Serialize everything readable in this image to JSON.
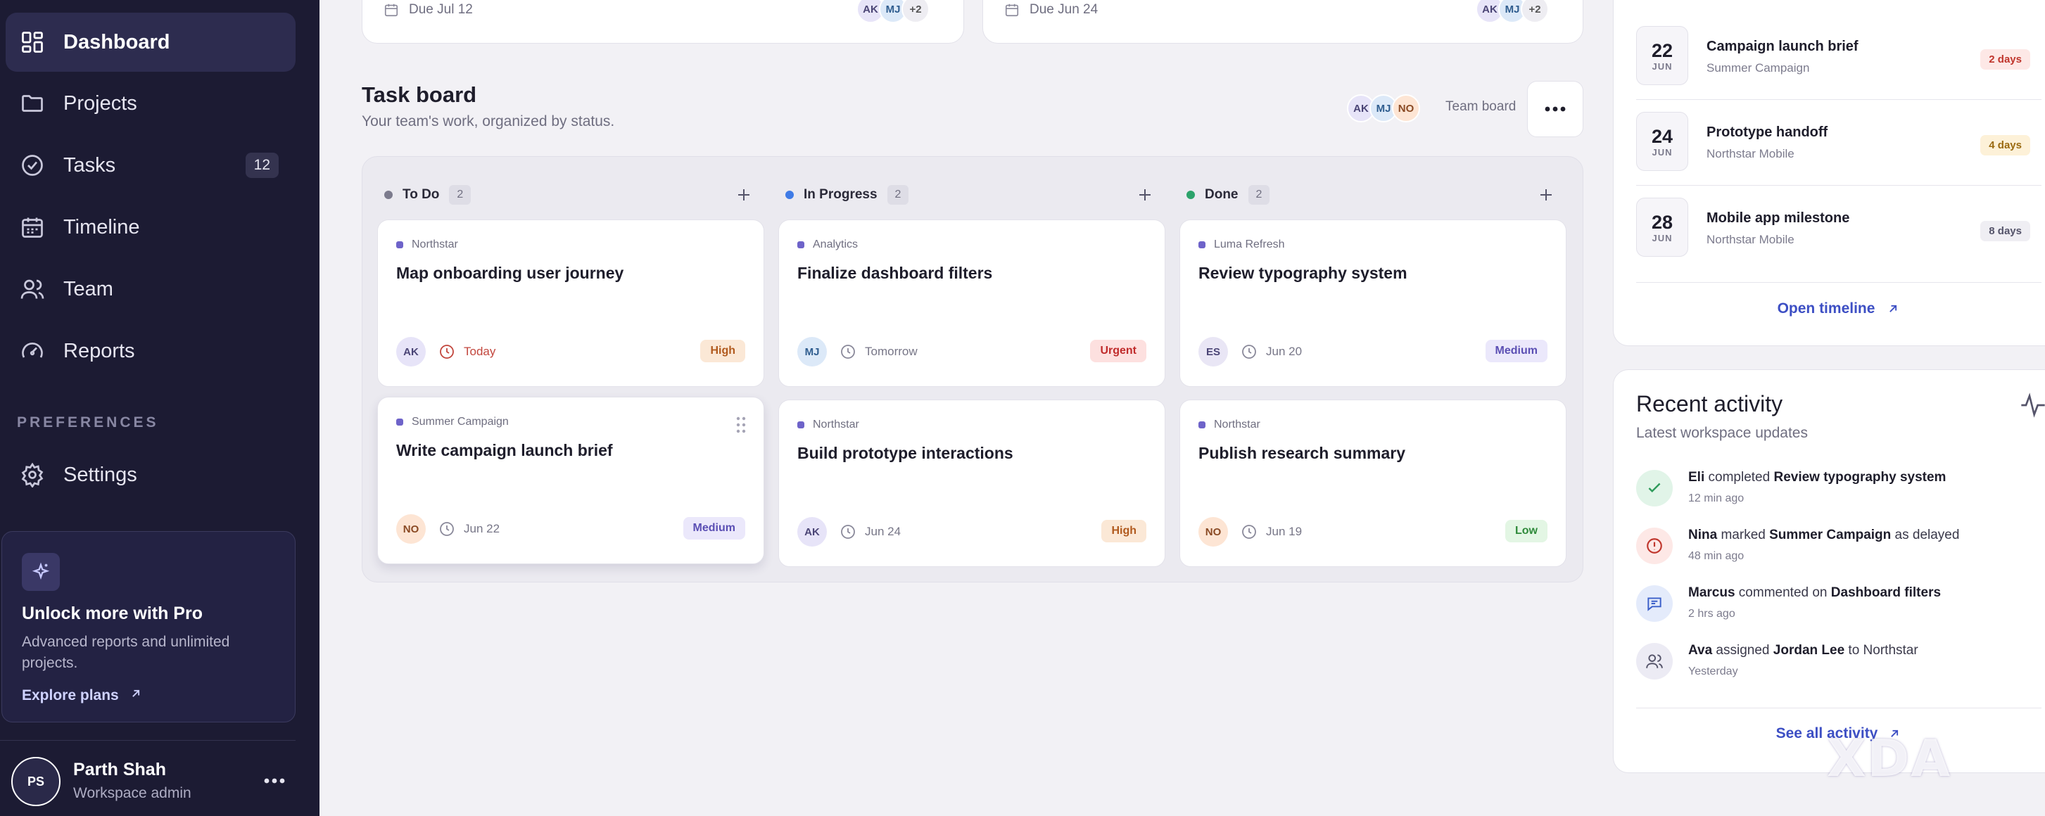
{
  "sidebar": {
    "nav": [
      {
        "label": "Dashboard",
        "icon": "dashboard-icon",
        "active": true
      },
      {
        "label": "Projects",
        "icon": "folder-icon"
      },
      {
        "label": "Tasks",
        "icon": "check-circle-icon",
        "badge": "12"
      },
      {
        "label": "Timeline",
        "icon": "calendar-icon"
      },
      {
        "label": "Team",
        "icon": "users-icon"
      },
      {
        "label": "Reports",
        "icon": "gauge-icon"
      }
    ],
    "preferences_label": "PREFERENCES",
    "settings_label": "Settings",
    "promo": {
      "title": "Unlock more with Pro",
      "description": "Advanced reports and unlimited projects.",
      "link": "Explore plans"
    },
    "user": {
      "initials": "PS",
      "name": "Parth Shah",
      "role": "Workspace admin"
    }
  },
  "top_cards": [
    {
      "due": "Due Jul 12",
      "avatars": [
        "AK",
        "MJ",
        "+2"
      ]
    },
    {
      "due": "Due Jun 24",
      "avatars": [
        "AK",
        "MJ",
        "+2"
      ]
    }
  ],
  "board": {
    "title": "Task board",
    "subtitle": "Your team's work, organized by status.",
    "team_avatars": [
      "AK",
      "MJ",
      "NO"
    ],
    "team_label": "Team board",
    "columns": [
      {
        "name": "To Do",
        "count": "2",
        "color": "#7c7b8d",
        "cards": [
          {
            "project": "Northstar",
            "title": "Map onboarding user journey",
            "assignee": "AK",
            "when": "Today",
            "priority": "High"
          },
          {
            "project": "Summer Campaign",
            "title": "Write campaign launch brief",
            "assignee": "NO",
            "when": "Jun 22",
            "priority": "Medium"
          }
        ]
      },
      {
        "name": "In Progress",
        "count": "2",
        "color": "#3f7be6",
        "cards": [
          {
            "project": "Analytics",
            "title": "Finalize dashboard filters",
            "assignee": "MJ",
            "when": "Tomorrow",
            "priority": "Urgent"
          },
          {
            "project": "Northstar",
            "title": "Build prototype interactions",
            "assignee": "AK",
            "when": "Jun 24",
            "priority": "High"
          }
        ]
      },
      {
        "name": "Done",
        "count": "2",
        "color": "#2ca36b",
        "cards": [
          {
            "project": "Luma Refresh",
            "title": "Review typography system",
            "assignee": "ES",
            "when": "Jun 20",
            "priority": "Medium"
          },
          {
            "project": "Northstar",
            "title": "Publish research summary",
            "assignee": "NO",
            "when": "Jun 19",
            "priority": "Low"
          }
        ]
      }
    ]
  },
  "deadlines": [
    {
      "day": "22",
      "month": "JUN",
      "title": "Campaign launch brief",
      "project": "Summer Campaign",
      "remaining": "2 days"
    },
    {
      "day": "24",
      "month": "JUN",
      "title": "Prototype handoff",
      "project": "Northstar Mobile",
      "remaining": "4 days"
    },
    {
      "day": "28",
      "month": "JUN",
      "title": "Mobile app milestone",
      "project": "Northstar Mobile",
      "remaining": "8 days"
    }
  ],
  "open_timeline": "Open timeline",
  "activity": {
    "title": "Recent activity",
    "subtitle": "Latest workspace updates",
    "items": [
      {
        "actor": "Eli",
        "verb": " completed ",
        "object": "Review typography system",
        "tail": "",
        "time": "12 min ago",
        "icon": "check-icon"
      },
      {
        "actor": "Nina",
        "verb": " marked ",
        "object": "Summer Campaign",
        "tail": " as delayed",
        "time": "48 min ago",
        "icon": "alert-icon"
      },
      {
        "actor": "Marcus",
        "verb": " commented on ",
        "object": "Dashboard filters",
        "tail": "",
        "time": "2 hrs ago",
        "icon": "comment-icon"
      },
      {
        "actor": "Ava",
        "verb": " assigned ",
        "object": "Jordan Lee",
        "tail": " to Northstar",
        "time": "Yesterday",
        "icon": "users-icon"
      }
    ],
    "see_all": "See all activity"
  },
  "watermark": "XDA",
  "colors": {
    "sidebar": "#1c1b33",
    "accent": "#3d4fc4",
    "background": "#f2f1f5"
  }
}
